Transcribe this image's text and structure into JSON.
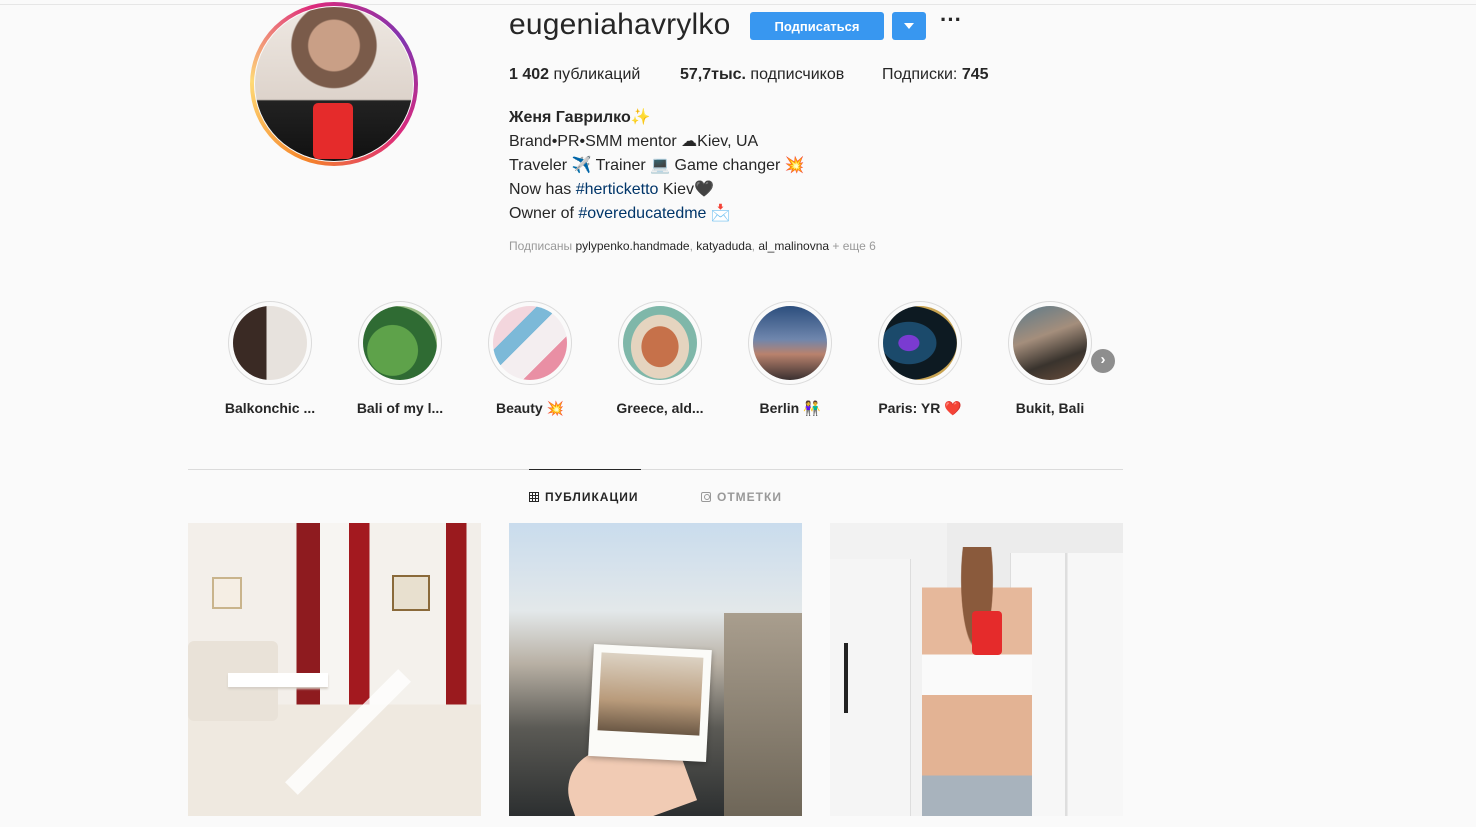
{
  "profile": {
    "username": "eugeniahavrylko",
    "follow_label": "Подписаться",
    "more_label": "···",
    "stats": {
      "posts_value": "1 402",
      "posts_label": " публикаций",
      "followers_value": "57,7тыс.",
      "followers_label": " подписчиков",
      "following_label": "Подписки: ",
      "following_value": "745"
    },
    "full_name": "Женя Гаврилко✨",
    "bio": {
      "line1": "Brand•PR•SMM mentor ☁Kiev, UA",
      "line2": "Traveler ✈️ Trainer 💻 Game changer 💥",
      "line3_prefix": "Now has ",
      "line3_tag": "#herticketto",
      "line3_suffix": " Kiev🖤",
      "line4_prefix": "Owner of ",
      "line4_tag": "#overeducatedme",
      "line4_suffix": " 📩"
    },
    "followed_by": {
      "prefix": "Подписаны ",
      "user1": "pylypenko.handmade",
      "sep1": ", ",
      "user2": "katyaduda",
      "sep2": ", ",
      "user3": "al_malinovna",
      "suffix": " + еще 6"
    }
  },
  "highlights": [
    {
      "label": "Balkonchic ..."
    },
    {
      "label": "Bali of my l..."
    },
    {
      "label": "Beauty 💥"
    },
    {
      "label": "Greece, ald..."
    },
    {
      "label": "Berlin 👫"
    },
    {
      "label": "Paris: YR ❤️"
    },
    {
      "label": "Bukit, Bali"
    }
  ],
  "highlights_next": "›",
  "tabs": [
    {
      "label": "ПУБЛИКАЦИИ",
      "active": true
    },
    {
      "label": "ОТМЕТКИ",
      "active": false
    }
  ],
  "icons": {
    "follow_dropdown": "caret-down-icon",
    "more": "ellipsis-icon",
    "posts_tab": "grid-icon",
    "tagged_tab": "tag-icon",
    "next": "chevron-right-icon"
  },
  "colors": {
    "accent": "#3897f0",
    "hashtag": "#003569",
    "muted": "#999999",
    "text": "#262626"
  }
}
